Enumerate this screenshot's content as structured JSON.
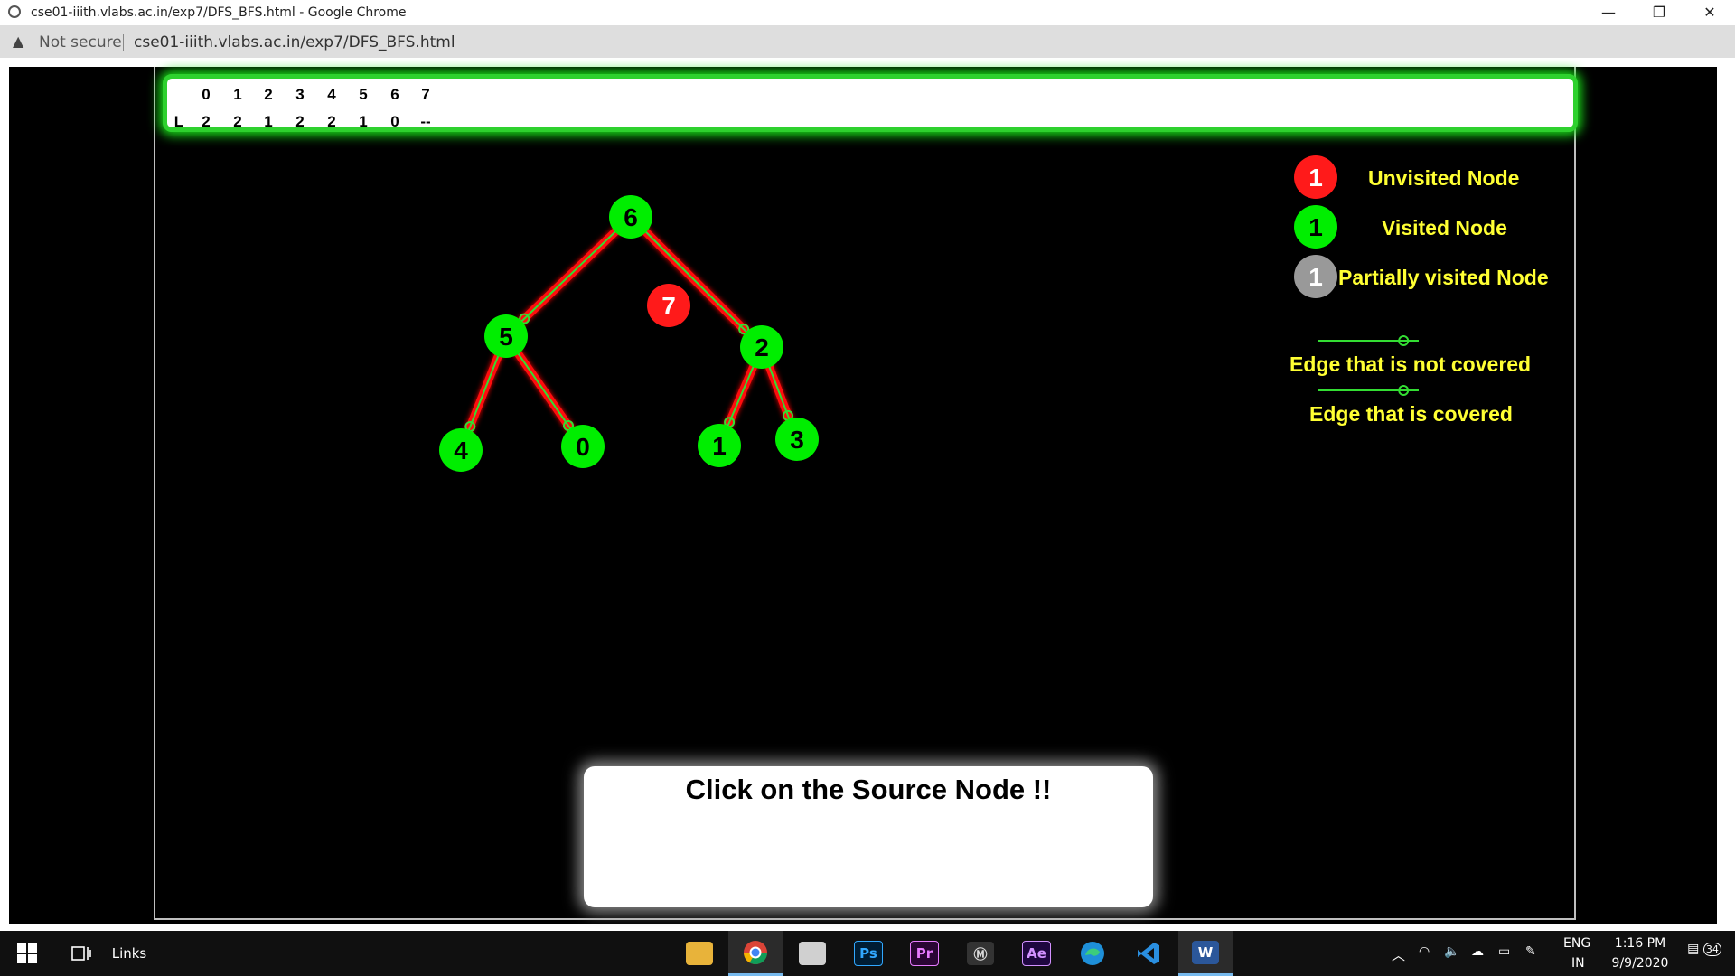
{
  "browser": {
    "window_title": "cse01-iiith.vlabs.ac.in/exp7/DFS_BFS.html - Google Chrome",
    "security_label": "Not secure",
    "url": "cse01-iiith.vlabs.ac.in/exp7/DFS_BFS.html",
    "minimize_glyph": "—",
    "restore_glyph": "❐",
    "close_glyph": "✕"
  },
  "array": {
    "row_label": "L",
    "indices": [
      "0",
      "1",
      "2",
      "3",
      "4",
      "5",
      "6",
      "7"
    ],
    "values": [
      "2",
      "2",
      "1",
      "2",
      "2",
      "1",
      "0",
      "--"
    ]
  },
  "graph": {
    "nodes": [
      {
        "id": "6",
        "state": "visited"
      },
      {
        "id": "5",
        "state": "visited"
      },
      {
        "id": "2",
        "state": "visited"
      },
      {
        "id": "7",
        "state": "unvisited"
      },
      {
        "id": "4",
        "state": "visited"
      },
      {
        "id": "0",
        "state": "visited"
      },
      {
        "id": "1",
        "state": "visited"
      },
      {
        "id": "3",
        "state": "visited"
      }
    ],
    "edges": [
      {
        "from": "6",
        "to": "5",
        "covered": true
      },
      {
        "from": "6",
        "to": "2",
        "covered": true
      },
      {
        "from": "5",
        "to": "4",
        "covered": true
      },
      {
        "from": "5",
        "to": "0",
        "covered": true
      },
      {
        "from": "2",
        "to": "1",
        "covered": true
      },
      {
        "from": "2",
        "to": "3",
        "covered": true
      }
    ]
  },
  "legend": {
    "sample_node": "1",
    "unvisited": "Unvisited Node",
    "visited": "Visited Node",
    "partial": "Partially visited Node",
    "edge_not_covered": "Edge that is not covered",
    "edge_covered": "Edge that is covered"
  },
  "message": {
    "text": "Click on the Source Node !!"
  },
  "colors": {
    "visited": "#00ee00",
    "unvisited": "#ff1a1a",
    "partial": "#999999",
    "edge_green": "#33dd33",
    "edge_red": "#ff1111",
    "legend_text": "#ffff33"
  },
  "taskbar": {
    "links_label": "Links",
    "apps": [
      {
        "icon": "file-explorer-icon",
        "label": ""
      },
      {
        "icon": "chrome-icon",
        "label": ""
      },
      {
        "icon": "printer-app-icon",
        "label": ""
      },
      {
        "icon": "photoshop-icon",
        "label": "Ps"
      },
      {
        "icon": "premiere-icon",
        "label": "Pr"
      },
      {
        "icon": "dark-app-icon",
        "label": "Ⓜ"
      },
      {
        "icon": "after-effects-icon",
        "label": "Ae"
      },
      {
        "icon": "edge-icon",
        "label": ""
      },
      {
        "icon": "vscode-icon",
        "label": ""
      },
      {
        "icon": "word-icon",
        "label": "W"
      }
    ],
    "language_top": "ENG",
    "language_bottom": "IN",
    "time": "1:16 PM",
    "date": "9/9/2020",
    "notification_count": "34"
  }
}
